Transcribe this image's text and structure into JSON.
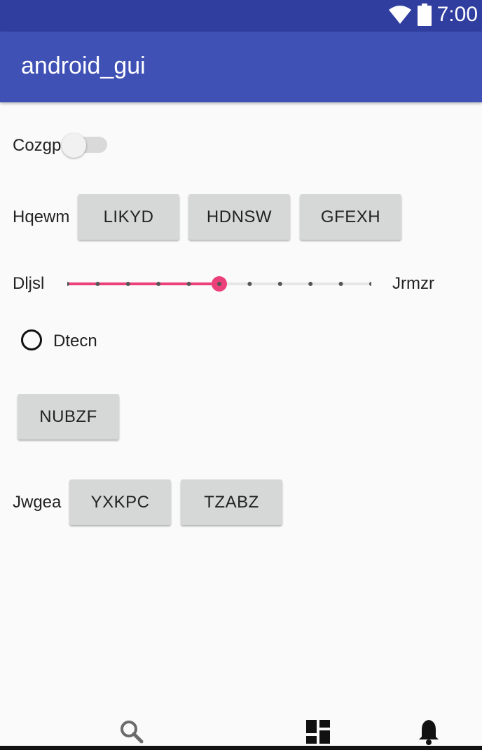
{
  "status_bar": {
    "time": "7:00",
    "icons": [
      "wifi-icon",
      "battery-icon"
    ]
  },
  "app_bar": {
    "title": "android_gui"
  },
  "switch_row": {
    "label": "Cozgp",
    "checked": false
  },
  "button_row_1": {
    "label": "Hqewm",
    "buttons": [
      "LIKYD",
      "HDNSW",
      "GFEXH"
    ]
  },
  "slider_row": {
    "left_label": "Dljsl",
    "right_label": "Jrmzr",
    "value": 5,
    "max": 10,
    "accent": "#ec407a"
  },
  "radio_row": {
    "label": "Dtecn",
    "checked": false
  },
  "single_button": {
    "label": "NUBZF"
  },
  "button_row_2": {
    "label": "Jwgea",
    "buttons": [
      "YXKPC",
      "TZABZ"
    ]
  },
  "bottom_nav": {
    "icons": [
      "search-icon",
      "dashboard-icon",
      "notifications-icon"
    ]
  },
  "colors": {
    "status_bar": "#303f9f",
    "app_bar": "#3f51b5",
    "button": "#d6d7d7"
  }
}
